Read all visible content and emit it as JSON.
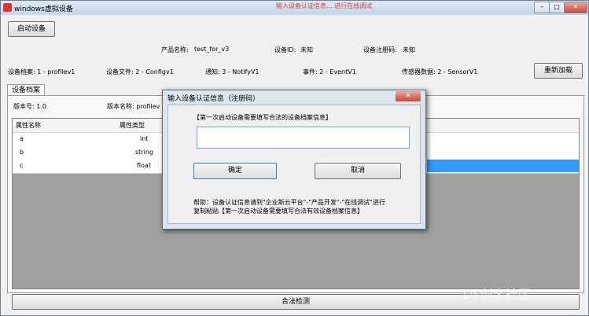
{
  "window": {
    "title": "windows虚拟设备",
    "banner": "输入设备认证信息... 进行在线调试"
  },
  "toolbar": {
    "start_label": "启动设备",
    "reload_label": "重新加载"
  },
  "info": {
    "product_name_label": "产品名称:",
    "product_name": "test_for_v3",
    "device_id_label": "设备ID:",
    "device_id": "未知",
    "reg_code_label": "设备注册码:",
    "reg_code": "未知"
  },
  "files": [
    "设备档案: 1 - profilev1",
    "设备文件: 2 - Configv1",
    "通知: 3 - NotifyV1",
    "事件: 2 - EventV1",
    "传感器数据: 2 - SensorV1"
  ],
  "tab": {
    "label": "设备档案",
    "version": "版本号: 1.0",
    "version_name": "版本名称: profilev"
  },
  "table": {
    "headers": [
      "属性名称",
      "属性类型"
    ],
    "rows": [
      [
        "a",
        "int"
      ],
      [
        "b",
        "string"
      ],
      [
        "c",
        "float"
      ]
    ]
  },
  "check_label": "合法检测",
  "dialog": {
    "title": "输入设备认证信息（注册码）",
    "prompt": "【第一次启动设备需要填写合法的设备档案信息】",
    "input_value": "",
    "ok_label": "确定",
    "cancel_label": "取消",
    "help_line1": "帮助：设备认证信息请到\"企业斯云平台\"-\"产品开发\"-\"在线调试\"进行",
    "help_line2": "复制粘贴【第一次启动设备需要填写合法有效设备档案信息】"
  },
  "watermark": "DF创客社区",
  "colors": {
    "selection": "#3399ff",
    "close": "#c6493a"
  }
}
